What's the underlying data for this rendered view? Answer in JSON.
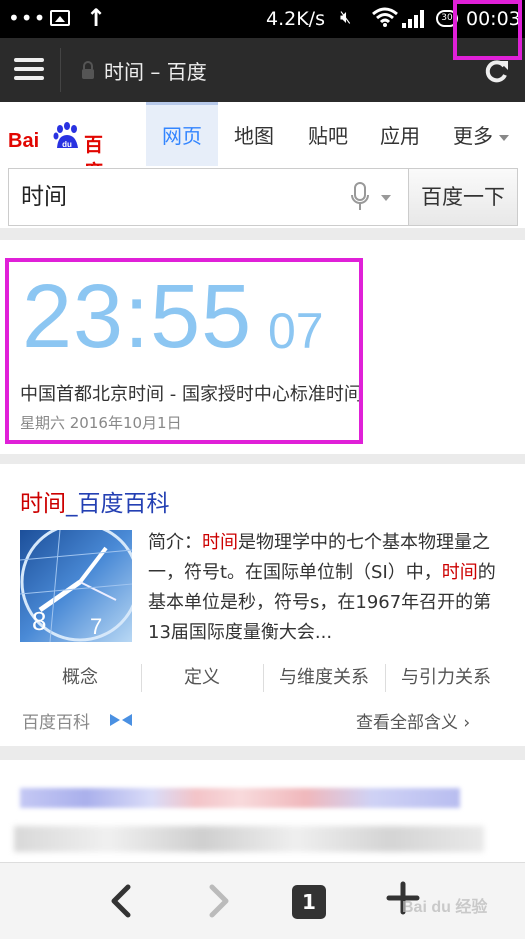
{
  "status_bar": {
    "network_speed": "4.2K/s",
    "time": "00:03",
    "battery": "30"
  },
  "browser": {
    "page_title": "时间 – 百度"
  },
  "nav": {
    "logo_text": "Bai",
    "logo_paw_text": "du",
    "logo_cn": "百度",
    "tabs": [
      {
        "label": "网页",
        "active": true
      },
      {
        "label": "地图",
        "active": false
      },
      {
        "label": "贴吧",
        "active": false
      },
      {
        "label": "应用",
        "active": false
      },
      {
        "label": "更多",
        "active": false
      }
    ]
  },
  "search": {
    "query": "时间",
    "button_label": "百度一下"
  },
  "time_card": {
    "time": "23:55",
    "seconds": "07",
    "description": "中国首都北京时间 - 国家授时中心标准时间",
    "date": "星期六  2016年10月1日"
  },
  "baike": {
    "title_hit": "时间",
    "title_rest": "_百度百科",
    "abstract": {
      "p1": "简介：",
      "hit1": "时间",
      "p2": "是物理学中的七个基本物理量之一，符号t。在国际单位制（SI）中，",
      "hit2": "时间",
      "p3": "的基本单位是秒，符号s，在1967年召开的第13届国际度量衡大会..."
    },
    "subtabs": [
      "概念",
      "定义",
      "与维度关系",
      "与引力关系"
    ],
    "source": "百度百科",
    "view_all": "查看全部含义"
  },
  "toolbar": {
    "tab_count": "1"
  },
  "watermark": {
    "text": "Bai du 经验"
  },
  "colors": {
    "baidu_red": "#e10601",
    "baidu_blue": "#2932e1",
    "clock_blue": "#8cc6f2",
    "link_blue": "#2440b3",
    "highlight_magenta": "#e020d8"
  }
}
